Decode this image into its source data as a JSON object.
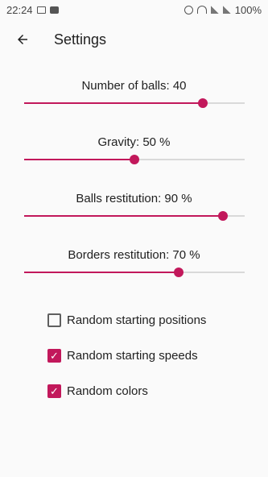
{
  "status_bar": {
    "time": "22:24",
    "battery": "100%"
  },
  "app_bar": {
    "title": "Settings"
  },
  "icons": {
    "back": "arrow-back-icon",
    "image": "image-icon",
    "chat": "chat-icon",
    "alarm": "alarm-icon",
    "wifi": "wifi-icon",
    "signal": "signal-icon"
  },
  "accent_color": "#c2185b",
  "sliders": [
    {
      "label": "Number of balls: 40",
      "value": 0.81
    },
    {
      "label": "Gravity: 50 %",
      "value": 0.5
    },
    {
      "label": "Balls restitution: 90 %",
      "value": 0.9
    },
    {
      "label": "Borders restitution: 70 %",
      "value": 0.7
    }
  ],
  "checkboxes": [
    {
      "label": "Random starting positions",
      "checked": false
    },
    {
      "label": "Random starting speeds",
      "checked": true
    },
    {
      "label": "Random colors",
      "checked": true
    }
  ]
}
